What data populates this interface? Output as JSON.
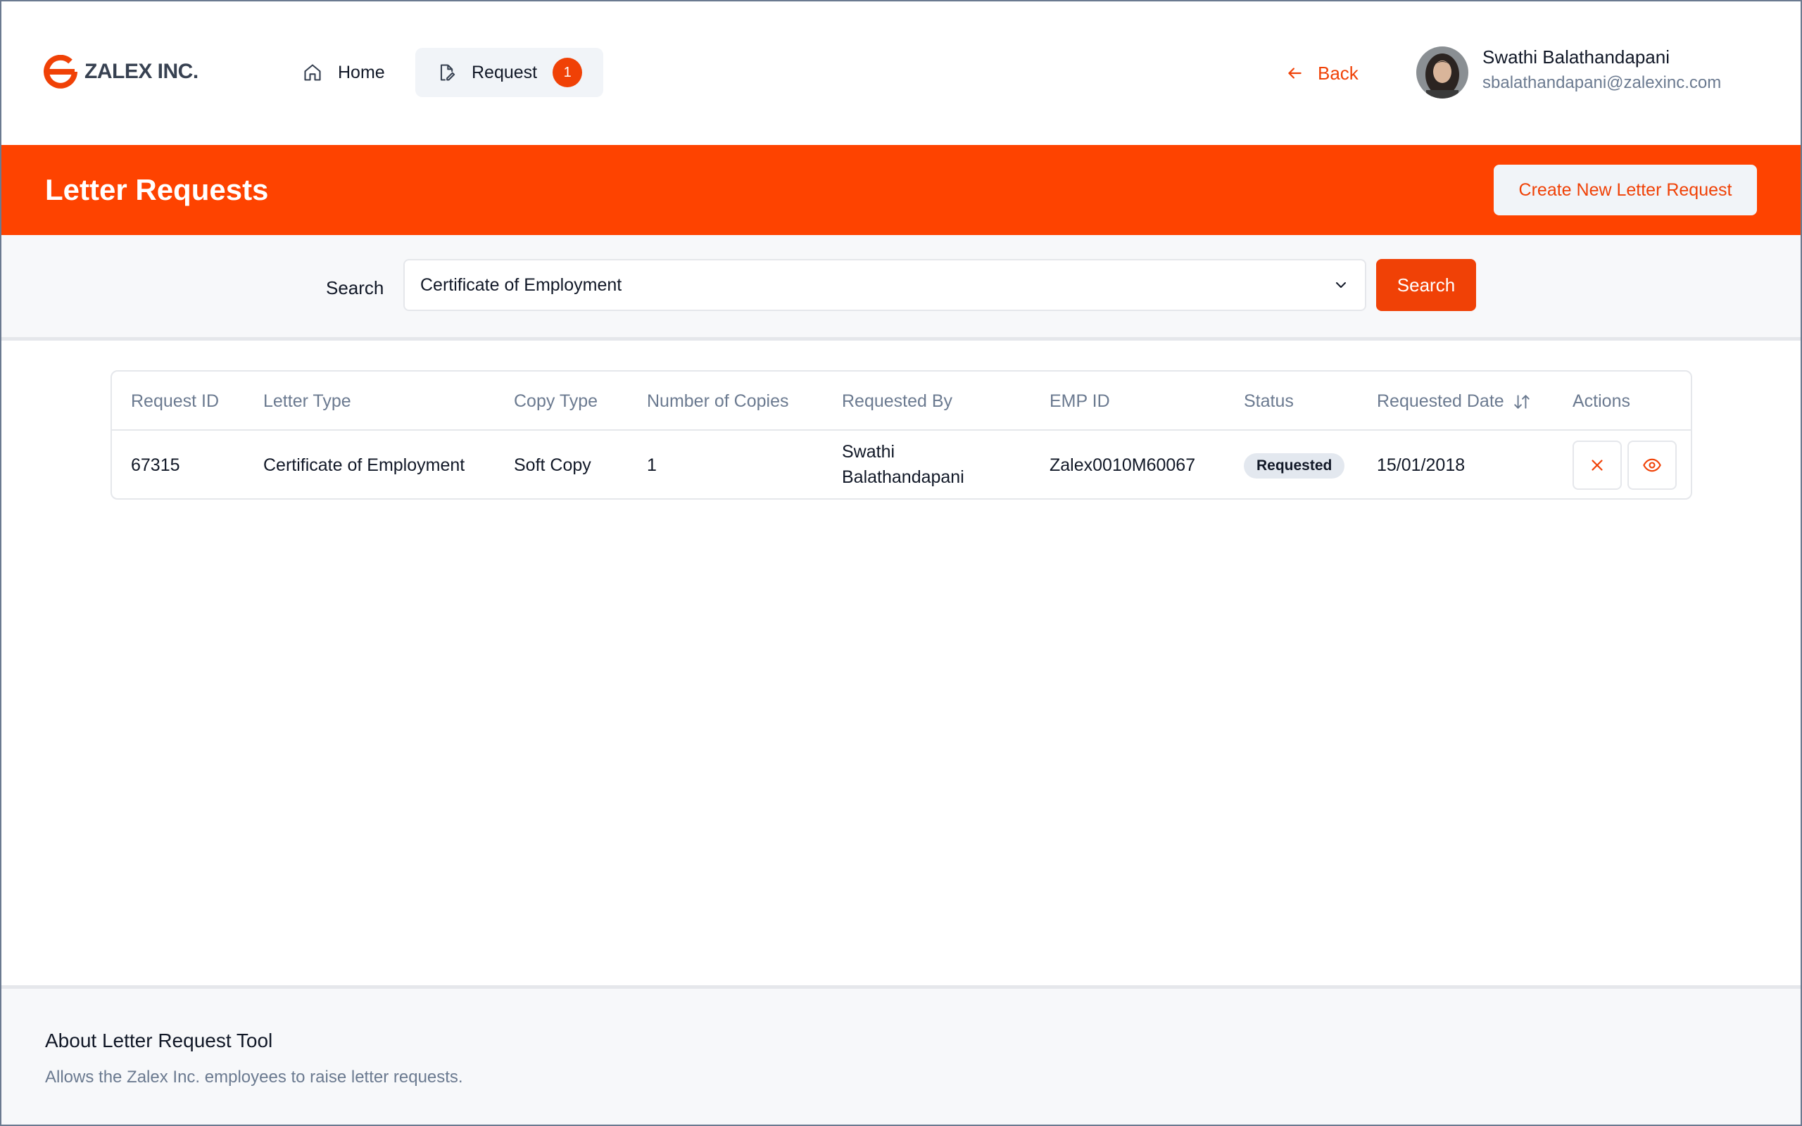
{
  "brand": {
    "name": "ZALEX INC.",
    "color": "#f04106"
  },
  "nav": {
    "home_label": "Home",
    "request_label": "Request",
    "request_badge": "1"
  },
  "header": {
    "back_label": "Back",
    "user_name": "Swathi Balathandapani",
    "user_email": "sbalathandapani@zalexinc.com"
  },
  "banner": {
    "title": "Letter Requests",
    "create_button": "Create New Letter Request",
    "background": "#fe4300"
  },
  "search": {
    "label": "Search",
    "selected_value": "Certificate of Employment",
    "button": "Search"
  },
  "table": {
    "columns": [
      "Request ID",
      "Letter Type",
      "Copy Type",
      "Number of Copies",
      "Requested By",
      "EMP ID",
      "Status",
      "Requested Date",
      "Actions"
    ],
    "rows": [
      {
        "request_id": "67315",
        "letter_type": "Certificate of Employment",
        "copy_type": "Soft Copy",
        "copies": "1",
        "requested_by": "Swathi Balathandapani",
        "emp_id": "Zalex0010M60067",
        "status": "Requested",
        "requested_date": "15/01/2018"
      }
    ]
  },
  "footer": {
    "title": "About Letter Request Tool",
    "description": "Allows the Zalex Inc. employees to raise letter requests."
  },
  "icons": {
    "logo": "zalex-logo-icon",
    "home": "home-icon",
    "request": "document-edit-icon",
    "back": "arrow-left-icon",
    "chevron": "chevron-down-icon",
    "sort": "sort-icon",
    "cancel": "close-icon",
    "view": "eye-icon"
  }
}
